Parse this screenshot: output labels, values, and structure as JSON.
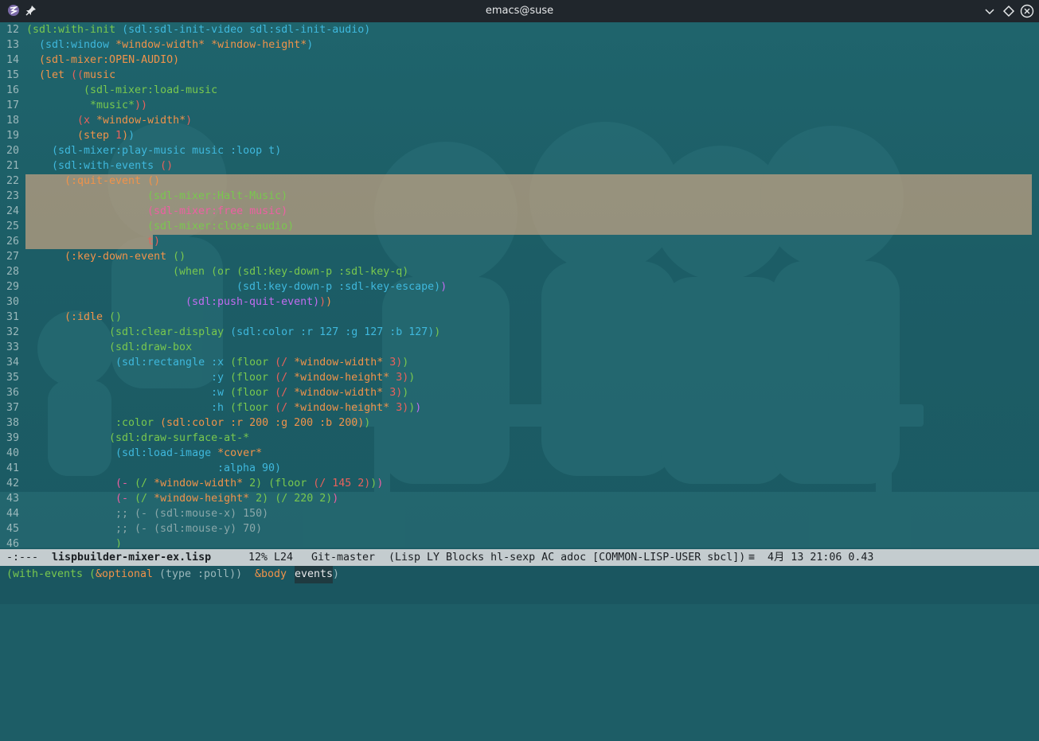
{
  "window": {
    "title": "emacs@suse"
  },
  "colors": {
    "default": "#3fb8dd",
    "keyword": "#79c84e",
    "variable": "#f0934a",
    "paren_red": "#e8625c",
    "paren_pink": "#ee5fa3",
    "paren_purple": "#c26cf0",
    "comment": "#8aa7a9"
  },
  "code_lines": [
    {
      "n": "12",
      "indent": 0,
      "parts": [
        [
          "(sdl:with-init",
          "keyword"
        ],
        [
          " (sdl:sdl-init-video sdl:sdl-init-audio)",
          "default"
        ]
      ]
    },
    {
      "n": "13",
      "indent": 2,
      "parts": [
        [
          "(sdl:window ",
          "default"
        ],
        [
          "*window-width* *window-height*",
          "variable"
        ],
        [
          ")",
          "default"
        ]
      ]
    },
    {
      "n": "14",
      "indent": 2,
      "parts": [
        [
          "(sdl-mixer:OPEN-AUDIO)",
          "variable"
        ]
      ]
    },
    {
      "n": "15",
      "indent": 2,
      "parts": [
        [
          "(let ",
          "variable"
        ],
        [
          "((",
          "paren_red"
        ],
        [
          "music",
          "variable"
        ]
      ]
    },
    {
      "n": "16",
      "indent": 9,
      "parts": [
        [
          "(sdl-mixer:load-music",
          "keyword"
        ]
      ]
    },
    {
      "n": "17",
      "indent": 10,
      "parts": [
        [
          "*music*",
          "keyword"
        ],
        [
          "))",
          "paren_red"
        ]
      ]
    },
    {
      "n": "18",
      "indent": 8,
      "parts": [
        [
          "(x ",
          "paren_red"
        ],
        [
          "*window-width*",
          "variable"
        ],
        [
          ")",
          "paren_red"
        ]
      ]
    },
    {
      "n": "19",
      "indent": 8,
      "parts": [
        [
          "(step ",
          "variable"
        ],
        [
          "1",
          "paren_red"
        ],
        [
          ")",
          "variable"
        ],
        [
          ")",
          "default"
        ]
      ]
    },
    {
      "n": "20",
      "indent": 4,
      "parts": [
        [
          "(sdl-mixer:play-music music :loop t)",
          "default"
        ]
      ]
    },
    {
      "n": "21",
      "indent": 4,
      "parts": [
        [
          "(sdl:with-events ",
          "default"
        ],
        [
          "()",
          "paren_red"
        ]
      ]
    },
    {
      "n": "22",
      "indent": 6,
      "parts": [
        [
          "(:quit-event ",
          "variable"
        ],
        [
          "()",
          "variable"
        ]
      ]
    },
    {
      "n": "23",
      "indent": 19,
      "parts": [
        [
          "(sdl-mixer:Halt-Music)",
          "keyword"
        ]
      ]
    },
    {
      "n": "24",
      "indent": 19,
      "parts": [
        [
          "(sdl-mixer:free music)",
          "paren_pink"
        ]
      ]
    },
    {
      "n": "25",
      "indent": 19,
      "parts": [
        [
          "(sdl-mixer:close-audio)",
          "keyword"
        ]
      ]
    },
    {
      "n": "26",
      "indent": 19,
      "parts": [
        [
          "t)",
          "paren_red"
        ]
      ]
    },
    {
      "n": "27",
      "indent": 6,
      "parts": [
        [
          "(:key-down-event ",
          "variable"
        ],
        [
          "()",
          "keyword"
        ]
      ]
    },
    {
      "n": "28",
      "indent": 23,
      "parts": [
        [
          "(when ",
          "keyword"
        ],
        [
          "(or ",
          "keyword"
        ],
        [
          "(sdl:key-down-p :sdl-key-q)",
          "keyword"
        ]
      ]
    },
    {
      "n": "29",
      "indent": 33,
      "parts": [
        [
          "(sdl:key-down-p :sdl-key-escape)",
          "default"
        ],
        [
          ")",
          "paren_purple"
        ]
      ]
    },
    {
      "n": "30",
      "indent": 25,
      "parts": [
        [
          "(sdl:push-quit-event)",
          "paren_purple"
        ],
        [
          ")",
          "paren_red"
        ],
        [
          ")",
          "variable"
        ]
      ]
    },
    {
      "n": "31",
      "indent": 6,
      "parts": [
        [
          "(:idle ",
          "variable"
        ],
        [
          "()",
          "keyword"
        ]
      ]
    },
    {
      "n": "32",
      "indent": 13,
      "parts": [
        [
          "(sdl:clear-display ",
          "keyword"
        ],
        [
          "(sdl:color :r 127 :g 127 :b 127)",
          "default"
        ],
        [
          ")",
          "keyword"
        ]
      ]
    },
    {
      "n": "33",
      "indent": 13,
      "parts": [
        [
          "(sdl:draw-box",
          "keyword"
        ]
      ]
    },
    {
      "n": "34",
      "indent": 14,
      "parts": [
        [
          "(sdl:rectangle :x ",
          "default"
        ],
        [
          "(floor ",
          "keyword"
        ],
        [
          "(/ ",
          "paren_red"
        ],
        [
          "*window-width*",
          "variable"
        ],
        [
          " 3)",
          "paren_red"
        ],
        [
          ")",
          "keyword"
        ]
      ]
    },
    {
      "n": "35",
      "indent": 29,
      "parts": [
        [
          ":y ",
          "default"
        ],
        [
          "(floor ",
          "keyword"
        ],
        [
          "(/ ",
          "paren_red"
        ],
        [
          "*window-height*",
          "variable"
        ],
        [
          " 3)",
          "paren_red"
        ],
        [
          ")",
          "keyword"
        ]
      ]
    },
    {
      "n": "36",
      "indent": 29,
      "parts": [
        [
          ":w ",
          "default"
        ],
        [
          "(floor ",
          "keyword"
        ],
        [
          "(/ ",
          "paren_red"
        ],
        [
          "*window-width*",
          "variable"
        ],
        [
          " 3)",
          "paren_red"
        ],
        [
          ")",
          "keyword"
        ]
      ]
    },
    {
      "n": "37",
      "indent": 29,
      "parts": [
        [
          ":h ",
          "default"
        ],
        [
          "(floor ",
          "keyword"
        ],
        [
          "(/ ",
          "paren_red"
        ],
        [
          "*window-height*",
          "variable"
        ],
        [
          " 3)",
          "paren_red"
        ],
        [
          ")",
          "keyword"
        ],
        [
          ")",
          "paren_purple"
        ]
      ]
    },
    {
      "n": "38",
      "indent": 14,
      "parts": [
        [
          ":color ",
          "keyword"
        ],
        [
          "(sdl:color :r 200 :g 200 :b 200)",
          "variable"
        ],
        [
          ")",
          "keyword"
        ]
      ]
    },
    {
      "n": "39",
      "indent": 13,
      "parts": [
        [
          "(sdl:draw-surface-at-*",
          "keyword"
        ]
      ]
    },
    {
      "n": "40",
      "indent": 14,
      "parts": [
        [
          "(sdl:load-image ",
          "default"
        ],
        [
          "*cover*",
          "variable"
        ]
      ]
    },
    {
      "n": "41",
      "indent": 30,
      "parts": [
        [
          ":alpha 90)",
          "default"
        ]
      ]
    },
    {
      "n": "42",
      "indent": 14,
      "parts": [
        [
          "(- ",
          "paren_pink"
        ],
        [
          "(/ ",
          "keyword"
        ],
        [
          "*window-width*",
          "variable"
        ],
        [
          " 2) ",
          "keyword"
        ],
        [
          "(floor ",
          "keyword"
        ],
        [
          "(/ ",
          "paren_red"
        ],
        [
          "145 2)",
          "paren_red"
        ],
        [
          ")",
          "keyword"
        ],
        [
          ")",
          "paren_pink"
        ]
      ]
    },
    {
      "n": "43",
      "indent": 14,
      "parts": [
        [
          "(- ",
          "paren_pink"
        ],
        [
          "(/ ",
          "keyword"
        ],
        [
          "*window-height*",
          "variable"
        ],
        [
          " 2) ",
          "keyword"
        ],
        [
          "(/ 220 2)",
          "keyword"
        ],
        [
          ")",
          "paren_pink"
        ]
      ]
    },
    {
      "n": "44",
      "indent": 14,
      "parts": [
        [
          ";; (- (sdl:mouse-x) 150)",
          "comment"
        ]
      ]
    },
    {
      "n": "45",
      "indent": 14,
      "parts": [
        [
          ";; (- (sdl:mouse-y) 70)",
          "comment"
        ]
      ]
    },
    {
      "n": "46",
      "indent": 14,
      "parts": [
        [
          ")",
          "keyword"
        ]
      ]
    }
  ],
  "modeline": {
    "status": "-:---",
    "buffer": "lispbuilder-mixer-ex.lisp",
    "position": "12% L24",
    "vc": "Git-master",
    "modes": "(Lisp LY Blocks hl-sexp AC adoc [COMMON-LISP-USER sbcl])",
    "indicator": "≡",
    "datetime": "4月 13 21:06 0.43"
  },
  "echo": {
    "open": "(with-events",
    "space1": " (",
    "optional": "&optional",
    "args": " (type :poll))",
    "space2": " ",
    "body": "&body",
    "space3": " ",
    "events": "events",
    "close": ")"
  }
}
